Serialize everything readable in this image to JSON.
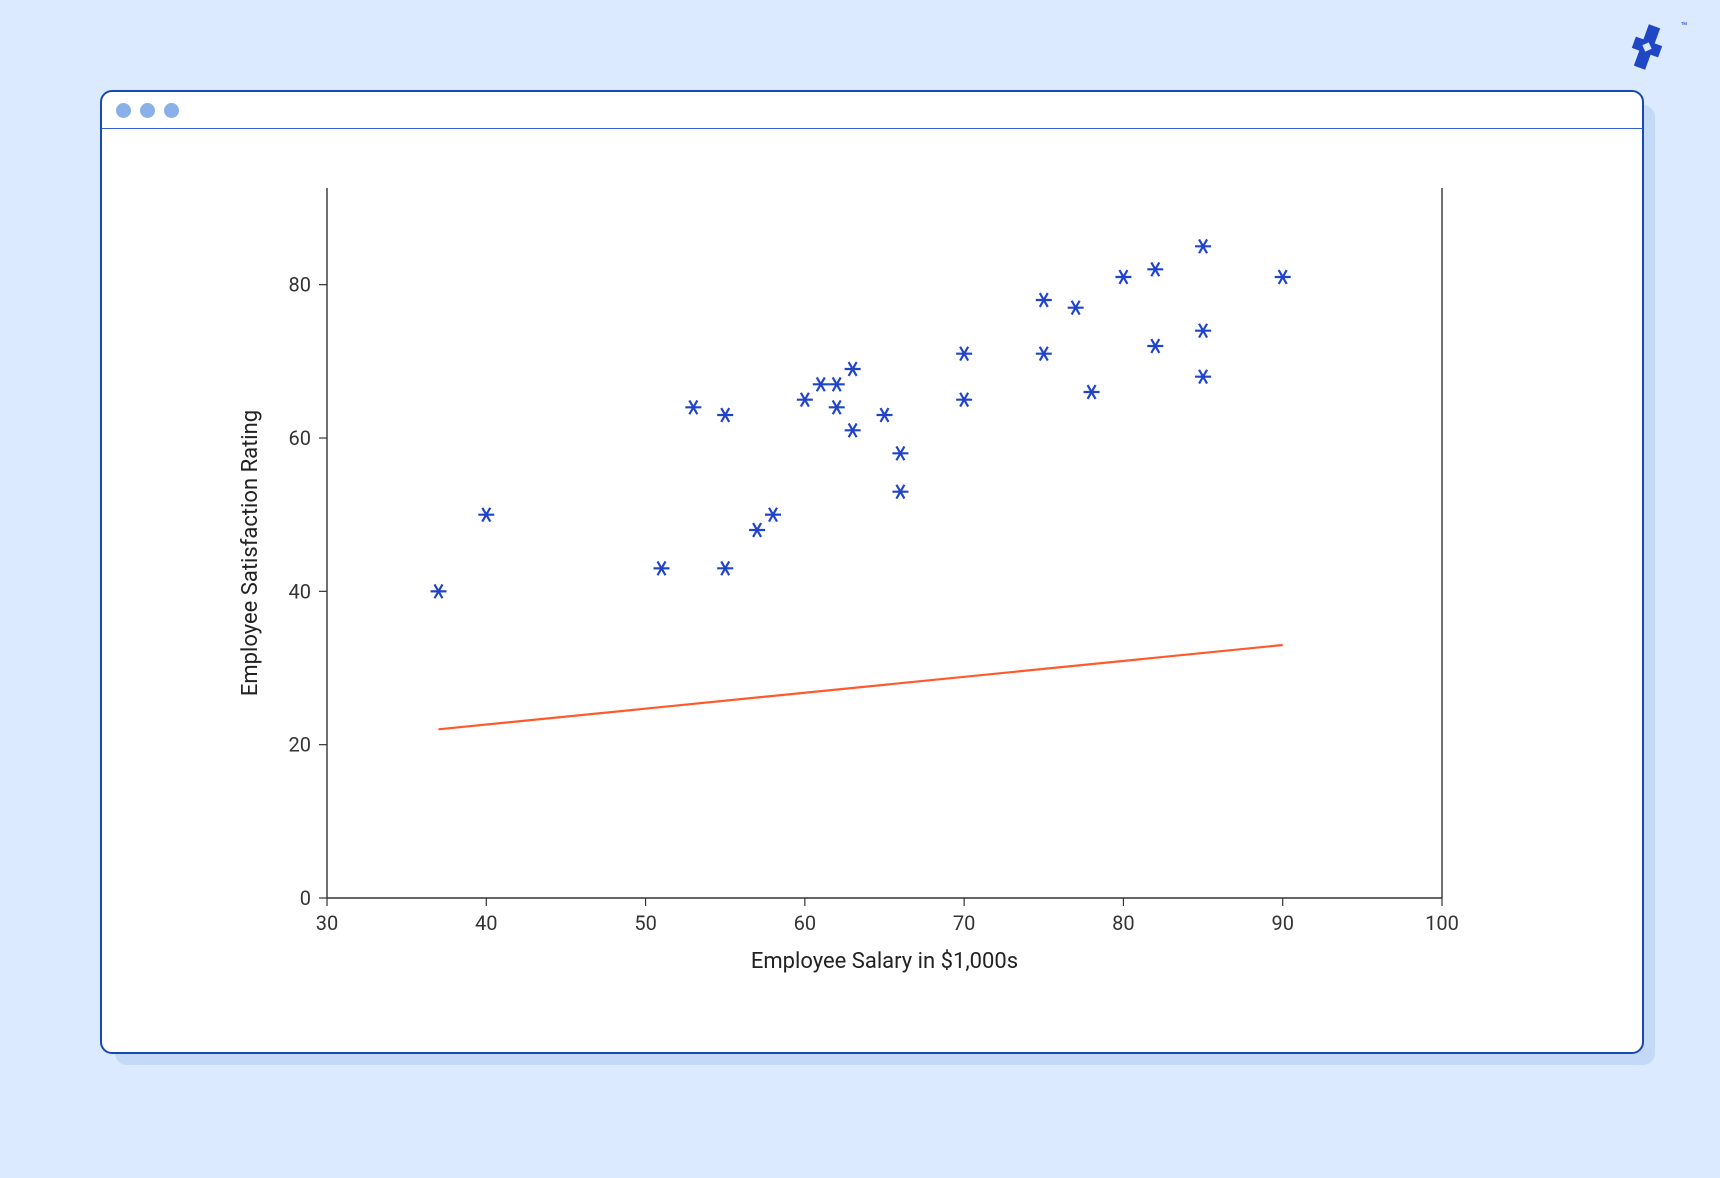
{
  "logo": {
    "tm": "™"
  },
  "chart_data": {
    "type": "scatter",
    "xlabel": "Employee Salary in $1,000s",
    "ylabel": "Employee Satisfaction Rating",
    "xlim": [
      30,
      100
    ],
    "ylim": [
      0,
      90
    ],
    "x_ticks": [
      30,
      40,
      50,
      60,
      70,
      80,
      90,
      100
    ],
    "y_ticks": [
      0,
      20,
      40,
      60,
      80
    ],
    "points": [
      {
        "x": 37,
        "y": 40
      },
      {
        "x": 40,
        "y": 50
      },
      {
        "x": 51,
        "y": 43
      },
      {
        "x": 53,
        "y": 64
      },
      {
        "x": 55,
        "y": 63
      },
      {
        "x": 55,
        "y": 43
      },
      {
        "x": 57,
        "y": 48
      },
      {
        "x": 58,
        "y": 50
      },
      {
        "x": 60,
        "y": 65
      },
      {
        "x": 61,
        "y": 67
      },
      {
        "x": 62,
        "y": 64
      },
      {
        "x": 62,
        "y": 67
      },
      {
        "x": 63,
        "y": 69
      },
      {
        "x": 63,
        "y": 61
      },
      {
        "x": 65,
        "y": 63
      },
      {
        "x": 66,
        "y": 58
      },
      {
        "x": 66,
        "y": 53
      },
      {
        "x": 70,
        "y": 71
      },
      {
        "x": 70,
        "y": 65
      },
      {
        "x": 75,
        "y": 78
      },
      {
        "x": 75,
        "y": 71
      },
      {
        "x": 77,
        "y": 77
      },
      {
        "x": 78,
        "y": 66
      },
      {
        "x": 80,
        "y": 81
      },
      {
        "x": 82,
        "y": 82
      },
      {
        "x": 82,
        "y": 72
      },
      {
        "x": 85,
        "y": 85
      },
      {
        "x": 85,
        "y": 74
      },
      {
        "x": 85,
        "y": 68
      },
      {
        "x": 90,
        "y": 81
      }
    ],
    "trend": {
      "x1": 37,
      "y1": 22,
      "x2": 90,
      "y2": 33
    }
  }
}
